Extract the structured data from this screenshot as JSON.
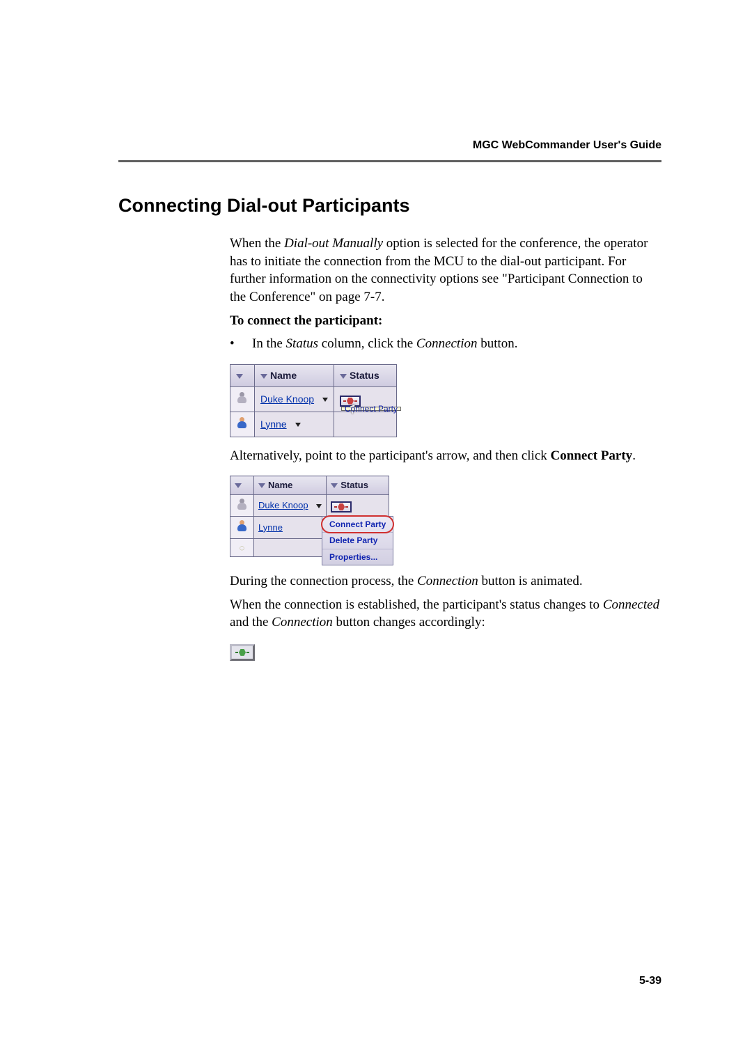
{
  "header": {
    "running": "MGC WebCommander User's Guide"
  },
  "section": {
    "title": "Connecting Dial-out Participants"
  },
  "para1": {
    "pre": "When the ",
    "em": "Dial-out Manually",
    "post": " option is selected for the conference, the operator has to initiate the connection from the MCU to the dial-out participant. For further information on the connectivity options see \"Participant Connection to the Conference\" on page 7-7."
  },
  "proc_heading": "To connect the participant:",
  "bullet": {
    "pre": "In the ",
    "em1": "Status",
    "mid": " column, click the ",
    "em2": "Connection",
    "post": " button."
  },
  "table": {
    "col_name": "Name",
    "col_status": "Status",
    "rows": [
      {
        "name": "Duke Knoop",
        "tooltip": "Connect Party"
      },
      {
        "name": "Lynne"
      }
    ]
  },
  "para2": {
    "pre": "Alternatively, point to the participant's arrow, and then click ",
    "b1": "Connect Party",
    "post": "."
  },
  "menu": {
    "items": [
      "Connect Party",
      "Delete Party",
      "Properties..."
    ]
  },
  "para3": {
    "pre": "During the connection process, the ",
    "em": "Connection",
    "post": " button is animated."
  },
  "para4": {
    "pre": "When the connection is established, the participant's status changes to ",
    "em1": "Connected",
    "mid": " and the ",
    "em2": "Connection",
    "post": " button changes accordingly:"
  },
  "footer": {
    "page_number": "5-39"
  }
}
